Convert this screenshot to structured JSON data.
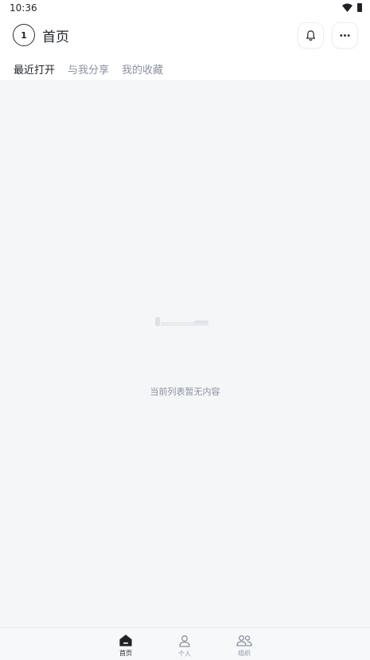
{
  "status_bar": {
    "time": "10:36"
  },
  "header": {
    "avatar_text": "1",
    "title": "首页"
  },
  "tabs": [
    {
      "label": "最近打开",
      "active": true
    },
    {
      "label": "与我分享",
      "active": false
    },
    {
      "label": "我的收藏",
      "active": false
    }
  ],
  "empty_state": {
    "message": "当前列表暂无内容"
  },
  "bottom_nav": [
    {
      "label": "首页",
      "icon": "home-icon",
      "active": true
    },
    {
      "label": "个人",
      "icon": "person-icon",
      "active": false
    },
    {
      "label": "组织",
      "icon": "group-icon",
      "active": false
    }
  ],
  "colors": {
    "background": "#f5f6f8",
    "text_primary": "#1f2329",
    "text_secondary": "#8a92a1"
  }
}
